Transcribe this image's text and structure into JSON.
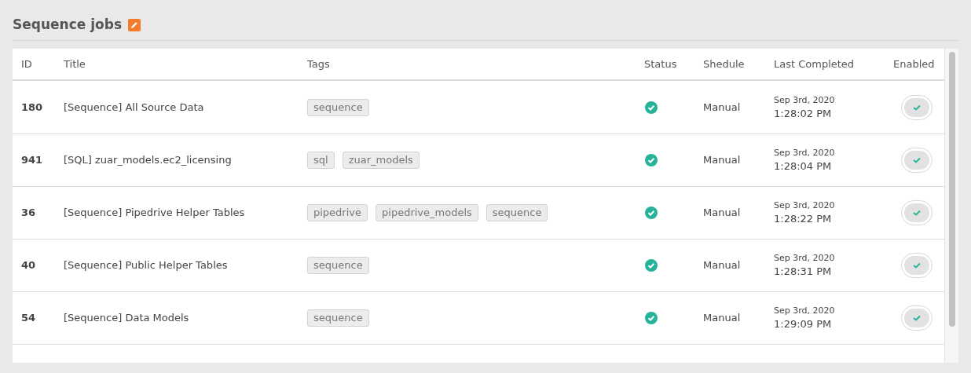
{
  "title": "Sequence jobs",
  "table": {
    "columns": [
      "ID",
      "Title",
      "Tags",
      "Status",
      "Shedule",
      "Last Completed",
      "Enabled"
    ],
    "rows": [
      {
        "id": "180",
        "title": "[Sequence] All Source Data",
        "tags": [
          "sequence"
        ],
        "succeeded": true,
        "schedule": "Manual",
        "date": "Sep 3rd, 2020",
        "time": "1:28:02 PM",
        "enabled": true
      },
      {
        "id": "941",
        "title": "[SQL] zuar_models.ec2_licensing",
        "tags": [
          "sql",
          "zuar_models"
        ],
        "succeeded": true,
        "schedule": "Manual",
        "date": "Sep 3rd, 2020",
        "time": "1:28:04 PM",
        "enabled": true
      },
      {
        "id": "36",
        "title": "[Sequence] Pipedrive Helper Tables",
        "tags": [
          "pipedrive",
          "pipedrive_models",
          "sequence"
        ],
        "succeeded": true,
        "schedule": "Manual",
        "date": "Sep 3rd, 2020",
        "time": "1:28:22 PM",
        "enabled": true
      },
      {
        "id": "40",
        "title": "[Sequence] Public Helper Tables",
        "tags": [
          "sequence"
        ],
        "succeeded": true,
        "schedule": "Manual",
        "date": "Sep 3rd, 2020",
        "time": "1:28:31 PM",
        "enabled": true
      },
      {
        "id": "54",
        "title": "[Sequence] Data Models",
        "tags": [
          "sequence"
        ],
        "succeeded": true,
        "schedule": "Manual",
        "date": "Sep 3rd, 2020",
        "time": "1:29:09 PM",
        "enabled": true
      }
    ]
  }
}
